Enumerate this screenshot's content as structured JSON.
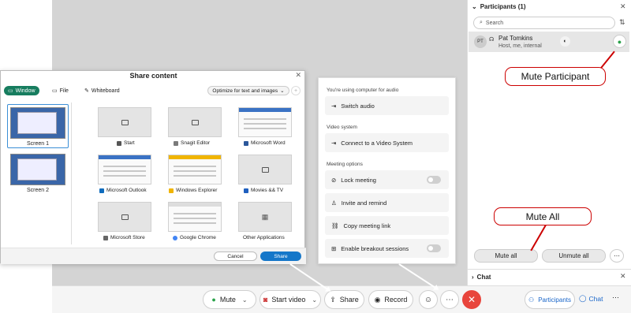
{
  "share_dialog": {
    "title": "Share content",
    "tabs": [
      {
        "label": "Window",
        "icon": "window-icon"
      },
      {
        "label": "File",
        "icon": "file-icon"
      },
      {
        "label": "Whiteboard",
        "icon": "pencil-icon"
      }
    ],
    "optimize": "Optimize for text and images",
    "screens": [
      "Screen 1",
      "Screen 2"
    ],
    "apps": [
      {
        "label": "Start"
      },
      {
        "label": "Snagit Editor"
      },
      {
        "label": "Microsoft Word",
        "color": "#2b579a"
      },
      {
        "label": "Microsoft Outlook",
        "color": "#0f6cbd"
      },
      {
        "label": "Windows Explorer",
        "color": "#f0b400"
      },
      {
        "label": "Movies && TV",
        "color": "#1f5fbf"
      },
      {
        "label": "Microsoft Store"
      },
      {
        "label": "Google Chrome",
        "color": "#4285f4"
      },
      {
        "label": "Other Applications"
      }
    ],
    "cancel": "Cancel",
    "share": "Share"
  },
  "menu": {
    "audio_section": "You're using computer for audio",
    "switch_audio": "Switch audio",
    "video_section": "Video system",
    "connect_video": "Connect to a Video System",
    "options_section": "Meeting options",
    "lock": "Lock meeting",
    "invite": "Invite and remind",
    "copy_link": "Copy meeting link",
    "breakout": "Enable breakout sessions"
  },
  "participants": {
    "header": "Participants (1)",
    "search_placeholder": "Search",
    "person": {
      "initials": "PT",
      "name": "Pat Tomkins",
      "role": "Host, me, internal"
    },
    "mute_all": "Mute all",
    "unmute_all": "Unmute all"
  },
  "chat": {
    "header": "Chat"
  },
  "toolbar": {
    "mute": "Mute",
    "start_video": "Start video",
    "share": "Share",
    "record": "Record",
    "participants": "Participants",
    "chat": "Chat"
  },
  "callouts": {
    "mute_participant": "Mute Participant",
    "mute_all": "Mute All"
  },
  "colors": {
    "accent": "#177d5f",
    "primary": "#1577c9",
    "end_call": "#e8453c",
    "callout_border": "#cc0000",
    "unmuted_mic": "#2aa24a"
  }
}
